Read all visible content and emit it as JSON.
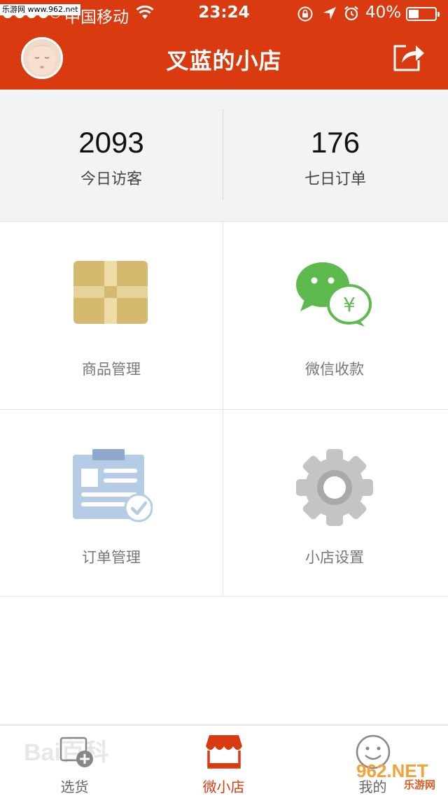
{
  "status_bar": {
    "watermark_site": "乐游网 www.962.net",
    "carrier": "中国移动",
    "time": "23:24",
    "battery_pct": "40%",
    "battery_level": 0.4
  },
  "header": {
    "title": "叉蓝的小店"
  },
  "stats": [
    {
      "value": "2093",
      "label": "今日访客"
    },
    {
      "value": "176",
      "label": "七日订单"
    }
  ],
  "menu": [
    {
      "label": "商品管理",
      "icon": "package-icon"
    },
    {
      "label": "微信收款",
      "icon": "wechat-pay-icon"
    },
    {
      "label": "订单管理",
      "icon": "order-clipboard-icon"
    },
    {
      "label": "小店设置",
      "icon": "gear-icon"
    }
  ],
  "tabs": [
    {
      "label": "选货",
      "icon": "add-product-icon",
      "active": false
    },
    {
      "label": "微小店",
      "icon": "shop-icon",
      "active": true
    },
    {
      "label": "我的",
      "icon": "smiley-icon",
      "active": false
    }
  ],
  "watermarks": {
    "baidu": "Bai百科",
    "site_962": "962.NET",
    "site_962_sub": "乐游网"
  },
  "colors": {
    "brand": "#d93a0f",
    "wechat_green": "#5dbb4e",
    "gear_gray": "#c4c4c4",
    "package_tan": "#d4b96e",
    "clipboard_blue": "#b5cbe6"
  }
}
